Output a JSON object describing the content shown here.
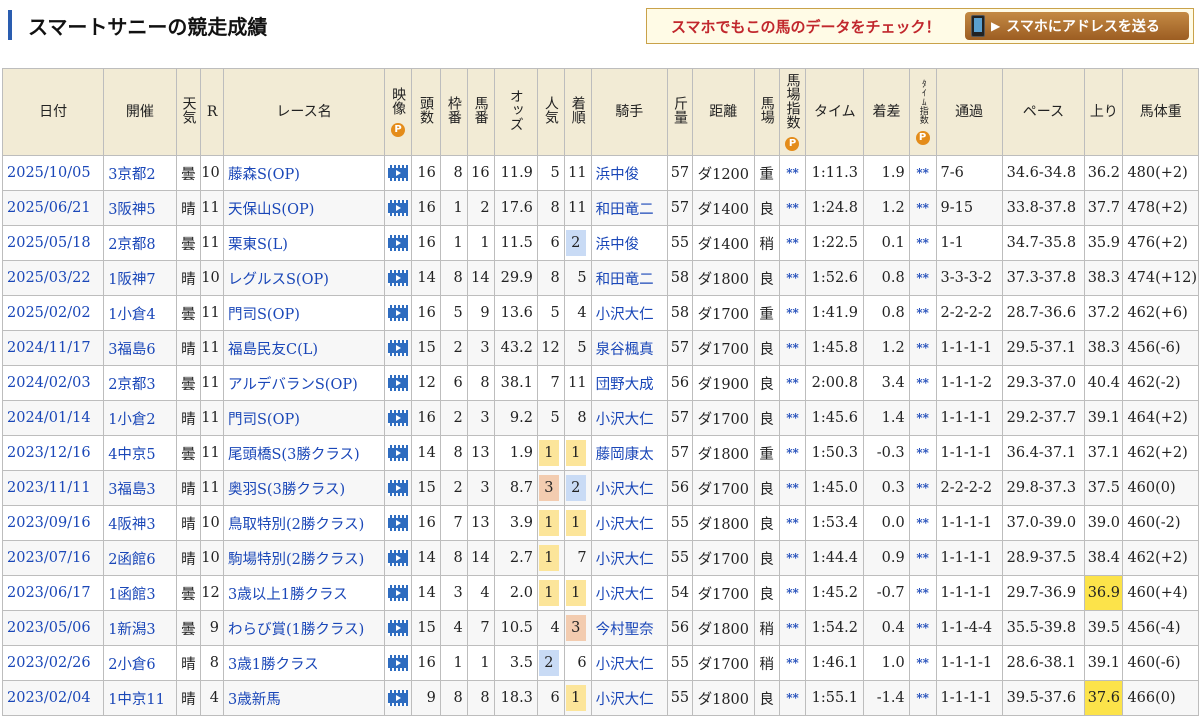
{
  "header": {
    "title": "スマートサニーの競走成績",
    "promo_text": "スマホでもこの馬のデータをチェック！",
    "promo_button": "スマホにアドレスを送る"
  },
  "table": {
    "columns": {
      "date": "日付",
      "venue": "開催",
      "weather": "天気",
      "race_no": "R",
      "race_name": "レース名",
      "video": "映像",
      "heads": "頭数",
      "frame": "枠番",
      "horse_no": "馬番",
      "odds": "オッズ",
      "pop": "人気",
      "finish": "着順",
      "jockey": "騎手",
      "weight": "斤量",
      "distance": "距離",
      "track": "馬場",
      "track_index": "馬場指数",
      "time": "タイム",
      "margin": "着差",
      "time_index": "ﾀｲﾑ指数",
      "passing": "通過",
      "pace": "ペース",
      "last": "上り",
      "body_weight": "馬体重",
      "p_badge": "P"
    },
    "rows": [
      {
        "date": "2025/10/05",
        "venue": "3京都2",
        "weather": "曇",
        "race_no": "10",
        "race_name": "藤森S(OP)",
        "heads": "16",
        "frame": "8",
        "horse_no": "16",
        "odds": "11.9",
        "pop": "5",
        "finish": "11",
        "jockey": "浜中俊",
        "weight": "57",
        "distance": "ダ1200",
        "track": "重",
        "track_index": "**",
        "time": "1:11.3",
        "margin": "1.9",
        "time_index": "**",
        "passing": "7-6",
        "pace": "34.6-34.8",
        "last": "36.2",
        "body_weight": "480(+2)",
        "pop_hl": "",
        "fin_hl": "",
        "last_hl": false
      },
      {
        "date": "2025/06/21",
        "venue": "3阪神5",
        "weather": "晴",
        "race_no": "11",
        "race_name": "天保山S(OP)",
        "heads": "16",
        "frame": "1",
        "horse_no": "2",
        "odds": "17.6",
        "pop": "8",
        "finish": "11",
        "jockey": "和田竜二",
        "weight": "57",
        "distance": "ダ1400",
        "track": "良",
        "track_index": "**",
        "time": "1:24.8",
        "margin": "1.2",
        "time_index": "**",
        "passing": "9-15",
        "pace": "33.8-37.8",
        "last": "37.7",
        "body_weight": "478(+2)",
        "pop_hl": "",
        "fin_hl": "",
        "last_hl": false
      },
      {
        "date": "2025/05/18",
        "venue": "2京都8",
        "weather": "曇",
        "race_no": "11",
        "race_name": "栗東S(L)",
        "heads": "16",
        "frame": "1",
        "horse_no": "1",
        "odds": "11.5",
        "pop": "6",
        "finish": "2",
        "jockey": "浜中俊",
        "weight": "55",
        "distance": "ダ1400",
        "track": "稍",
        "track_index": "**",
        "time": "1:22.5",
        "margin": "0.1",
        "time_index": "**",
        "passing": "1-1",
        "pace": "34.7-35.8",
        "last": "35.9",
        "body_weight": "476(+2)",
        "pop_hl": "",
        "fin_hl": "2",
        "last_hl": false
      },
      {
        "date": "2025/03/22",
        "venue": "1阪神7",
        "weather": "晴",
        "race_no": "10",
        "race_name": "レグルスS(OP)",
        "heads": "14",
        "frame": "8",
        "horse_no": "14",
        "odds": "29.9",
        "pop": "8",
        "finish": "5",
        "jockey": "和田竜二",
        "weight": "58",
        "distance": "ダ1800",
        "track": "良",
        "track_index": "**",
        "time": "1:52.6",
        "margin": "0.8",
        "time_index": "**",
        "passing": "3-3-3-2",
        "pace": "37.3-37.8",
        "last": "38.3",
        "body_weight": "474(+12)",
        "pop_hl": "",
        "fin_hl": "",
        "last_hl": false
      },
      {
        "date": "2025/02/02",
        "venue": "1小倉4",
        "weather": "曇",
        "race_no": "11",
        "race_name": "門司S(OP)",
        "heads": "16",
        "frame": "5",
        "horse_no": "9",
        "odds": "13.6",
        "pop": "5",
        "finish": "4",
        "jockey": "小沢大仁",
        "weight": "58",
        "distance": "ダ1700",
        "track": "重",
        "track_index": "**",
        "time": "1:41.9",
        "margin": "0.8",
        "time_index": "**",
        "passing": "2-2-2-2",
        "pace": "28.7-36.6",
        "last": "37.2",
        "body_weight": "462(+6)",
        "pop_hl": "",
        "fin_hl": "",
        "last_hl": false
      },
      {
        "date": "2024/11/17",
        "venue": "3福島6",
        "weather": "晴",
        "race_no": "11",
        "race_name": "福島民友C(L)",
        "heads": "15",
        "frame": "2",
        "horse_no": "3",
        "odds": "43.2",
        "pop": "12",
        "finish": "5",
        "jockey": "泉谷楓真",
        "weight": "57",
        "distance": "ダ1700",
        "track": "良",
        "track_index": "**",
        "time": "1:45.8",
        "margin": "1.2",
        "time_index": "**",
        "passing": "1-1-1-1",
        "pace": "29.5-37.1",
        "last": "38.3",
        "body_weight": "456(-6)",
        "pop_hl": "",
        "fin_hl": "",
        "last_hl": false
      },
      {
        "date": "2024/02/03",
        "venue": "2京都3",
        "weather": "曇",
        "race_no": "11",
        "race_name": "アルデバランS(OP)",
        "heads": "12",
        "frame": "6",
        "horse_no": "8",
        "odds": "38.1",
        "pop": "7",
        "finish": "11",
        "jockey": "団野大成",
        "weight": "56",
        "distance": "ダ1900",
        "track": "良",
        "track_index": "**",
        "time": "2:00.8",
        "margin": "3.4",
        "time_index": "**",
        "passing": "1-1-1-2",
        "pace": "29.3-37.0",
        "last": "40.4",
        "body_weight": "462(-2)",
        "pop_hl": "",
        "fin_hl": "",
        "last_hl": false
      },
      {
        "date": "2024/01/14",
        "venue": "1小倉2",
        "weather": "晴",
        "race_no": "11",
        "race_name": "門司S(OP)",
        "heads": "16",
        "frame": "2",
        "horse_no": "3",
        "odds": "9.2",
        "pop": "5",
        "finish": "8",
        "jockey": "小沢大仁",
        "weight": "57",
        "distance": "ダ1700",
        "track": "良",
        "track_index": "**",
        "time": "1:45.6",
        "margin": "1.4",
        "time_index": "**",
        "passing": "1-1-1-1",
        "pace": "29.2-37.7",
        "last": "39.1",
        "body_weight": "464(+2)",
        "pop_hl": "",
        "fin_hl": "",
        "last_hl": false
      },
      {
        "date": "2023/12/16",
        "venue": "4中京5",
        "weather": "曇",
        "race_no": "11",
        "race_name": "尾頭橋S(3勝クラス)",
        "heads": "14",
        "frame": "8",
        "horse_no": "13",
        "odds": "1.9",
        "pop": "1",
        "finish": "1",
        "jockey": "藤岡康太",
        "weight": "57",
        "distance": "ダ1800",
        "track": "重",
        "track_index": "**",
        "time": "1:50.3",
        "margin": "-0.3",
        "time_index": "**",
        "passing": "1-1-1-1",
        "pace": "36.4-37.1",
        "last": "37.1",
        "body_weight": "462(+2)",
        "pop_hl": "1",
        "fin_hl": "1",
        "last_hl": false
      },
      {
        "date": "2023/11/11",
        "venue": "3福島3",
        "weather": "晴",
        "race_no": "11",
        "race_name": "奥羽S(3勝クラス)",
        "heads": "15",
        "frame": "2",
        "horse_no": "3",
        "odds": "8.7",
        "pop": "3",
        "finish": "2",
        "jockey": "小沢大仁",
        "weight": "56",
        "distance": "ダ1700",
        "track": "良",
        "track_index": "**",
        "time": "1:45.0",
        "margin": "0.3",
        "time_index": "**",
        "passing": "2-2-2-2",
        "pace": "29.8-37.3",
        "last": "37.5",
        "body_weight": "460(0)",
        "pop_hl": "3",
        "fin_hl": "2",
        "last_hl": false
      },
      {
        "date": "2023/09/16",
        "venue": "4阪神3",
        "weather": "晴",
        "race_no": "10",
        "race_name": "鳥取特別(2勝クラス)",
        "heads": "16",
        "frame": "7",
        "horse_no": "13",
        "odds": "3.9",
        "pop": "1",
        "finish": "1",
        "jockey": "小沢大仁",
        "weight": "55",
        "distance": "ダ1800",
        "track": "良",
        "track_index": "**",
        "time": "1:53.4",
        "margin": "0.0",
        "time_index": "**",
        "passing": "1-1-1-1",
        "pace": "37.0-39.0",
        "last": "39.0",
        "body_weight": "460(-2)",
        "pop_hl": "1",
        "fin_hl": "1",
        "last_hl": false
      },
      {
        "date": "2023/07/16",
        "venue": "2函館6",
        "weather": "晴",
        "race_no": "10",
        "race_name": "駒場特別(2勝クラス)",
        "heads": "14",
        "frame": "8",
        "horse_no": "14",
        "odds": "2.7",
        "pop": "1",
        "finish": "7",
        "jockey": "小沢大仁",
        "weight": "55",
        "distance": "ダ1700",
        "track": "良",
        "track_index": "**",
        "time": "1:44.4",
        "margin": "0.9",
        "time_index": "**",
        "passing": "1-1-1-1",
        "pace": "28.9-37.5",
        "last": "38.4",
        "body_weight": "462(+2)",
        "pop_hl": "1",
        "fin_hl": "",
        "last_hl": false
      },
      {
        "date": "2023/06/17",
        "venue": "1函館3",
        "weather": "曇",
        "race_no": "12",
        "race_name": "3歳以上1勝クラス",
        "heads": "14",
        "frame": "3",
        "horse_no": "4",
        "odds": "2.0",
        "pop": "1",
        "finish": "1",
        "jockey": "小沢大仁",
        "weight": "54",
        "distance": "ダ1700",
        "track": "良",
        "track_index": "**",
        "time": "1:45.2",
        "margin": "-0.7",
        "time_index": "**",
        "passing": "1-1-1-1",
        "pace": "29.7-36.9",
        "last": "36.9",
        "body_weight": "460(+4)",
        "pop_hl": "1",
        "fin_hl": "1",
        "last_hl": true
      },
      {
        "date": "2023/05/06",
        "venue": "1新潟3",
        "weather": "曇",
        "race_no": "9",
        "race_name": "わらび賞(1勝クラス)",
        "heads": "15",
        "frame": "4",
        "horse_no": "7",
        "odds": "10.5",
        "pop": "4",
        "finish": "3",
        "jockey": "今村聖奈",
        "weight": "56",
        "distance": "ダ1800",
        "track": "稍",
        "track_index": "**",
        "time": "1:54.2",
        "margin": "0.4",
        "time_index": "**",
        "passing": "1-1-4-4",
        "pace": "35.5-39.8",
        "last": "39.5",
        "body_weight": "456(-4)",
        "pop_hl": "",
        "fin_hl": "3",
        "last_hl": false
      },
      {
        "date": "2023/02/26",
        "venue": "2小倉6",
        "weather": "晴",
        "race_no": "8",
        "race_name": "3歳1勝クラス",
        "heads": "16",
        "frame": "1",
        "horse_no": "1",
        "odds": "3.5",
        "pop": "2",
        "finish": "6",
        "jockey": "小沢大仁",
        "weight": "55",
        "distance": "ダ1700",
        "track": "稍",
        "track_index": "**",
        "time": "1:46.1",
        "margin": "1.0",
        "time_index": "**",
        "passing": "1-1-1-1",
        "pace": "28.6-38.1",
        "last": "39.1",
        "body_weight": "460(-6)",
        "pop_hl": "2",
        "fin_hl": "",
        "last_hl": false
      },
      {
        "date": "2023/02/04",
        "venue": "1中京11",
        "weather": "晴",
        "race_no": "4",
        "race_name": "3歳新馬",
        "heads": "9",
        "frame": "8",
        "horse_no": "8",
        "odds": "18.3",
        "pop": "6",
        "finish": "1",
        "jockey": "小沢大仁",
        "weight": "55",
        "distance": "ダ1800",
        "track": "良",
        "track_index": "**",
        "time": "1:55.1",
        "margin": "-1.4",
        "time_index": "**",
        "passing": "1-1-1-1",
        "pace": "39.5-37.6",
        "last": "37.6",
        "body_weight": "466(0)",
        "pop_hl": "",
        "fin_hl": "1",
        "last_hl": true
      }
    ]
  }
}
